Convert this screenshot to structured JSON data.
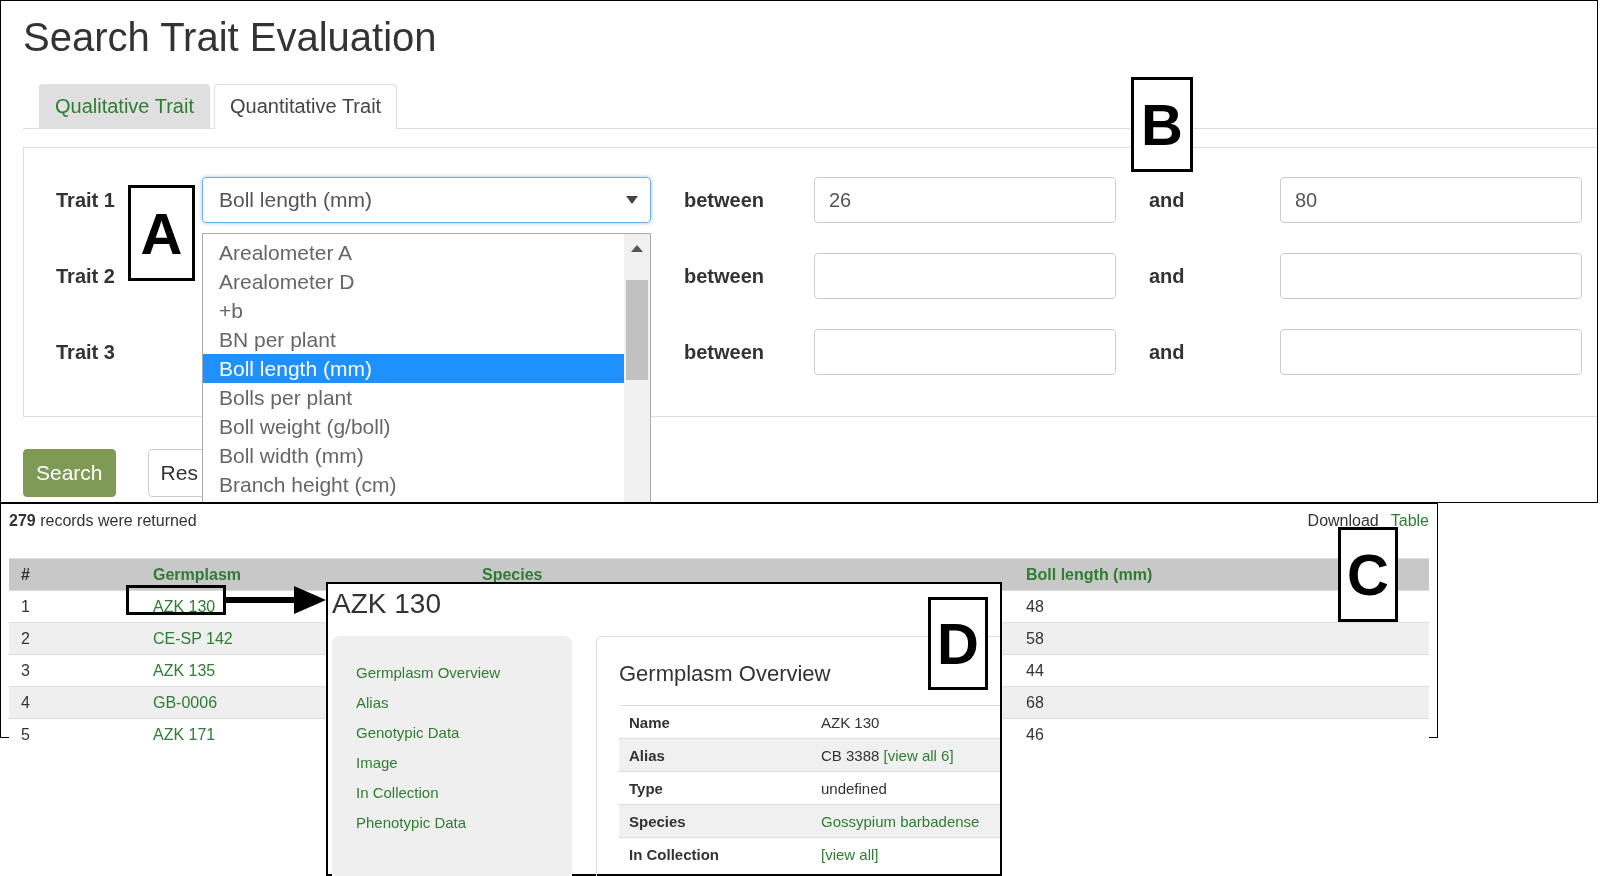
{
  "search_page": {
    "title": "Search Trait Evaluation",
    "tabs": [
      {
        "label": "Qualitative Trait",
        "selected": false
      },
      {
        "label": "Quantitative Trait",
        "selected": true
      }
    ],
    "traits": [
      {
        "label": "Trait 1",
        "select_value": "Boll length (mm)",
        "between_label": "between",
        "min_value": "26",
        "and_label": "and",
        "max_value": "80"
      },
      {
        "label": "Trait 2",
        "between_label": "between",
        "and_label": "and"
      },
      {
        "label": "Trait 3",
        "between_label": "between",
        "and_label": "and"
      }
    ],
    "dropdown_options": [
      {
        "label": "Arealometer A",
        "selected": false
      },
      {
        "label": "Arealometer D",
        "selected": false
      },
      {
        "label": "+b",
        "selected": false
      },
      {
        "label": "BN per plant",
        "selected": false
      },
      {
        "label": "Boll length (mm)",
        "selected": true
      },
      {
        "label": "Bolls per plant",
        "selected": false
      },
      {
        "label": "Boll weight (g/boll)",
        "selected": false
      },
      {
        "label": "Boll width (mm)",
        "selected": false
      },
      {
        "label": "Branch height (cm)",
        "selected": false
      }
    ],
    "buttons": [
      {
        "label": "Search",
        "kind": "primary"
      },
      {
        "label": "Res",
        "kind": "default"
      }
    ]
  },
  "results": {
    "summary": "**279** records were returned",
    "download_label": "Download",
    "table_link": "Table",
    "columns": [
      "#",
      "Germplasm",
      "Species",
      "Boll length (mm)"
    ],
    "rows": [
      {
        "num": "1",
        "germplasm": "AZK 130",
        "boll_length": "48"
      },
      {
        "num": "2",
        "germplasm": "CE-SP 142",
        "boll_length": "58"
      },
      {
        "num": "3",
        "germplasm": "AZK 135",
        "boll_length": "44"
      },
      {
        "num": "4",
        "germplasm": "GB-0006",
        "boll_length": "68"
      },
      {
        "num": "5",
        "germplasm": "AZK 171",
        "boll_length": "46"
      }
    ]
  },
  "detail": {
    "title": "AZK 130",
    "nav": [
      "Germplasm Overview",
      "Alias",
      "Genotypic Data",
      "Image",
      "In Collection",
      "Phenotypic Data"
    ],
    "heading": "Germplasm Overview",
    "rows": [
      {
        "label": "Name",
        "value": "AZK 130"
      },
      {
        "label": "Alias",
        "value": "CB 3388 ",
        "link": "[view all 6]"
      },
      {
        "label": "Type",
        "value": "undefined"
      },
      {
        "label": "Species",
        "link": "Gossypium barbadense"
      },
      {
        "label": "In Collection",
        "link": "[view all]"
      }
    ]
  },
  "callouts": [
    {
      "label": "A"
    },
    {
      "label": "B"
    },
    {
      "label": "C"
    },
    {
      "label": "D"
    }
  ]
}
